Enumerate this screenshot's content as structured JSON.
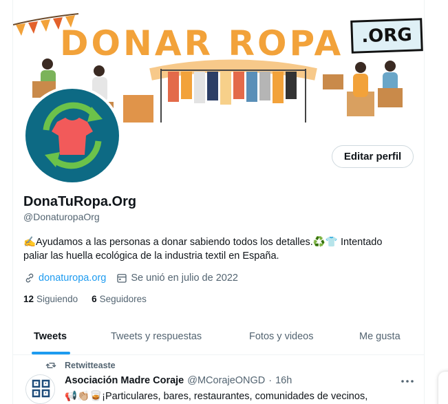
{
  "banner": {
    "title": "DONAR ROPA",
    "org_badge": ".ORG"
  },
  "profile": {
    "name": "DonaTuRopa.Org",
    "handle": "@DonaturopaOrg",
    "edit_button": "Editar perfil",
    "bio": "✍️Ayudamos a las personas a donar sabiendo todos los detalles.♻️👕 Intentado paliar las huella ecológica de la industria textil en España.",
    "website": "donaturopa.org",
    "joined": "Se unió en julio de 2022",
    "following_count": "12",
    "following_label": "Siguiendo",
    "followers_count": "6",
    "followers_label": "Seguidores"
  },
  "tabs": [
    {
      "label": "Tweets",
      "active": true
    },
    {
      "label": "Tweets y respuestas",
      "active": false
    },
    {
      "label": "Fotos y videos",
      "active": false
    },
    {
      "label": "Me gusta",
      "active": false
    }
  ],
  "tweet": {
    "retweet_label": "Retwitteaste",
    "author": "Asociación Madre Coraje",
    "handle": "@MCorajeONGD",
    "dot": "·",
    "time": "16h",
    "text": "📢👏🏼🥃¡Particulares, bares, restaurantes, comunidades de vecinos,"
  },
  "colors": {
    "accent": "#1d9bf0",
    "banner_orange": "#f2a23a",
    "avatar_bg": "#0d6a84",
    "shirt": "#f25a5a",
    "arrows": "#6cc24a"
  }
}
